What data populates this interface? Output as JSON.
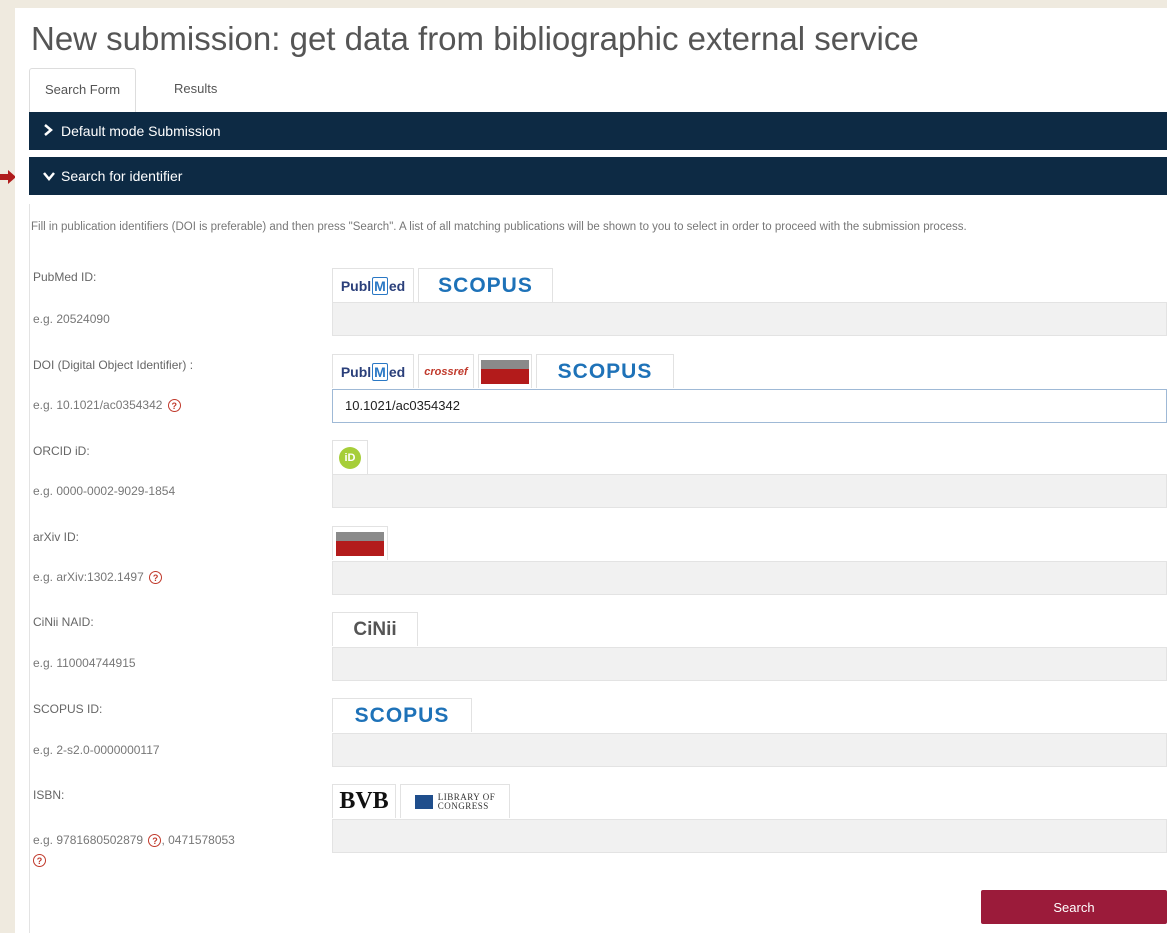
{
  "page_title": "New submission: get data from bibliographic external service",
  "tabs": [
    {
      "label": "Search Form",
      "active": true
    },
    {
      "label": "Results",
      "active": false
    }
  ],
  "panels": {
    "default_mode": "Default mode Submission",
    "search_identifier": "Search for identifier"
  },
  "description": "Fill in publication identifiers (DOI is preferable) and then press \"Search\". A list of all matching publications will be shown to you to select in order to proceed with the submission process.",
  "fields": {
    "pubmed": {
      "label": "PubMed ID:",
      "example": "e.g. 20524090",
      "value": "",
      "logos": [
        "PubMed",
        "SCOPUS"
      ]
    },
    "doi": {
      "label": "DOI (Digital Object Identifier) :",
      "example": "e.g. 10.1021/ac0354342",
      "value": "10.1021/ac0354342",
      "logos": [
        "PubMed",
        "CrossRef",
        "arXiv.org",
        "SCOPUS"
      ]
    },
    "orcid": {
      "label": "ORCID iD:",
      "example": "e.g. 0000-0002-9029-1854",
      "value": "",
      "logos": [
        "ORCID"
      ]
    },
    "arxiv": {
      "label": "arXiv ID:",
      "example": "e.g. arXiv:1302.1497",
      "value": "",
      "logos": [
        "arXiv.org"
      ]
    },
    "cinii": {
      "label": "CiNii NAID:",
      "example": "e.g. 110004744915",
      "value": "",
      "logos": [
        "CiNii"
      ]
    },
    "scopus": {
      "label": "SCOPUS ID:",
      "example": "e.g. 2-s2.0-0000000117",
      "value": "",
      "logos": [
        "SCOPUS"
      ]
    },
    "isbn": {
      "label": "ISBN:",
      "example_a": "e.g. 9781680502879",
      "example_b": ", 0471578053",
      "value": "",
      "logos": [
        "BVB",
        "LIBRARY OF CONGRESS"
      ]
    }
  },
  "logo_text": {
    "pubmed_a": "Publ",
    "pubmed_m": "M",
    "pubmed_b": "ed",
    "scopus": "SCOPUS",
    "crossref": "crossref",
    "orcid": "iD",
    "cinii": "CiNii",
    "bvb": "BVB",
    "loc_line1": "LIBRARY OF",
    "loc_line2": "CONGRESS",
    "help": "?"
  },
  "search_button": "Search",
  "colors": {
    "panel_header": "#0d2a44",
    "search_button": "#9b1b3a",
    "help_icon": "#c0392b",
    "arrow": "#b01c1c",
    "background": "#efeadf"
  }
}
